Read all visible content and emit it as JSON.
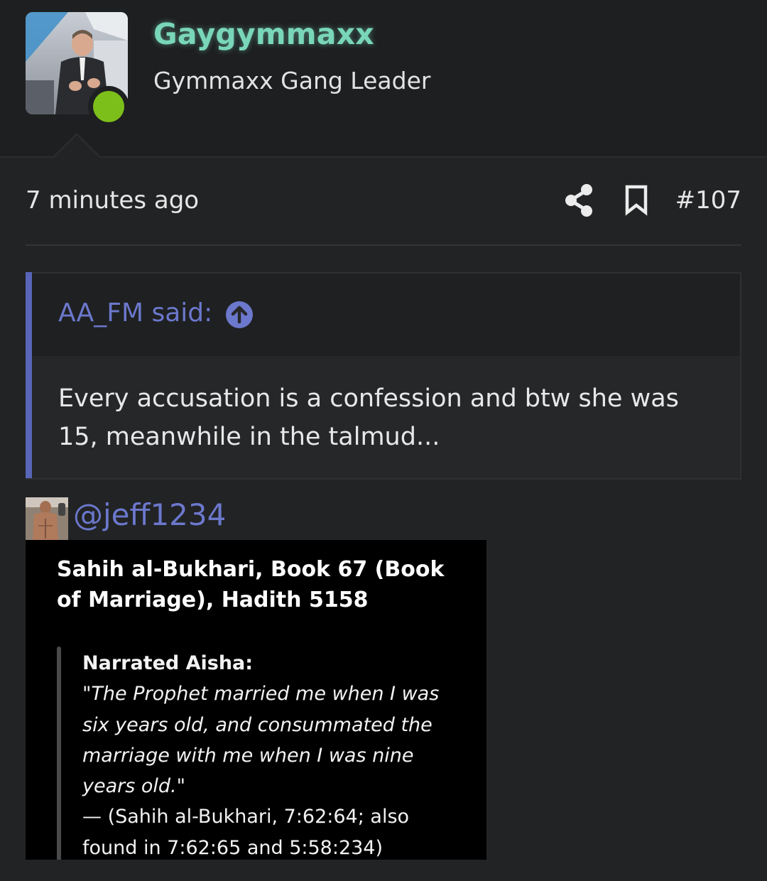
{
  "user": {
    "name": "Gaygymmaxx",
    "title": "Gymmaxx Gang Leader",
    "online": true,
    "name_color": "#79d6b9",
    "online_color": "#7cbf1a"
  },
  "post": {
    "timestamp": "7 minutes ago",
    "number": "#107",
    "actions": {
      "share_icon": "share-icon",
      "bookmark_icon": "bookmark-icon"
    }
  },
  "quote": {
    "author_said": "AA_FM said:",
    "jump_icon": "arrow-up-circle-icon",
    "text": "Every accusation is a confession and btw she was 15, meanwhile in the talmud...",
    "accent_color": "#5865b8"
  },
  "embed": {
    "handle": "@jeff1234",
    "title": "Sahih al-Bukhari, Book 67 (Book of Marriage), Hadith 5158",
    "narrator": "Narrated Aisha:",
    "hadith_text": "\"The Prophet married me when I was six years old, and consummated the marriage with me when I was nine years old.\"",
    "source": "— (Sahih al-Bukhari, 7:62:64; also found in 7:62:65 and 5:58:234)"
  }
}
